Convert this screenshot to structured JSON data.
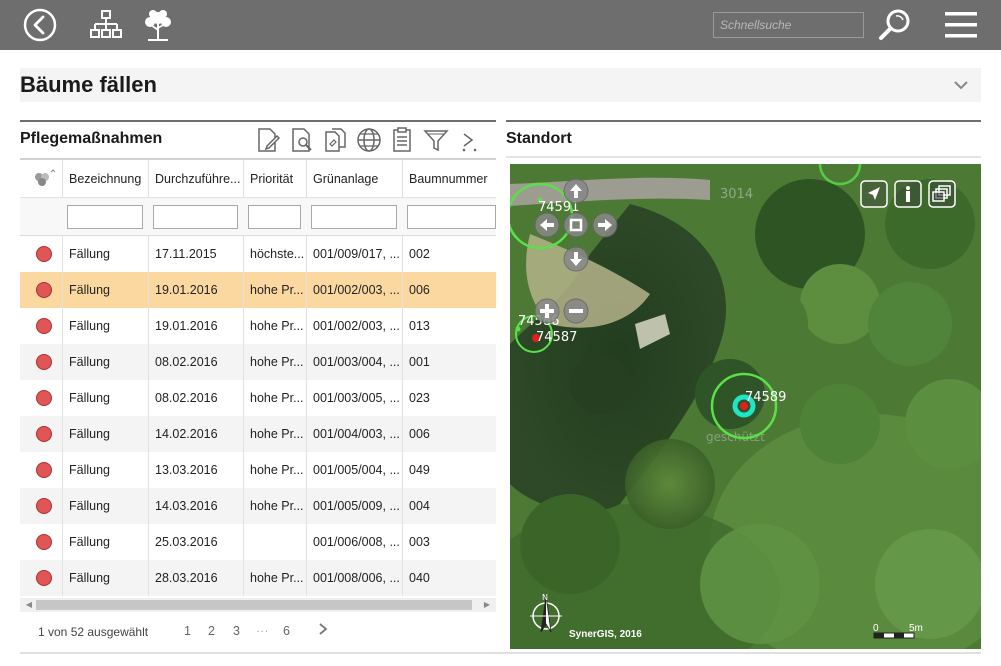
{
  "app": {
    "search_placeholder": "Schnellsuche",
    "icons": [
      "back-icon",
      "sitemap-icon",
      "tree-icon",
      "search-icon",
      "menu-icon"
    ]
  },
  "page": {
    "title": "Bäume fällen"
  },
  "left_panel": {
    "title": "Pflegemaßnahmen",
    "toolbar_icons": [
      "edit-icon",
      "search-document-icon",
      "copy-icon",
      "globe-icon",
      "clipboard-icon",
      "filter-icon",
      "more-icon"
    ],
    "columns": [
      "Bezeichnung",
      "Durchzuführe...",
      "Priorität",
      "Grünanlage",
      "Baumnummer"
    ],
    "rows": [
      {
        "bez": "Fällung",
        "datum": "17.11.2015",
        "prio": "höchste...",
        "anlage": "001/009/017, ...",
        "nr": "002"
      },
      {
        "bez": "Fällung",
        "datum": "19.01.2016",
        "prio": "hohe Pr...",
        "anlage": "001/002/003, ...",
        "nr": "006"
      },
      {
        "bez": "Fällung",
        "datum": "19.01.2016",
        "prio": "hohe Pr...",
        "anlage": "001/002/003, ...",
        "nr": "013"
      },
      {
        "bez": "Fällung",
        "datum": "08.02.2016",
        "prio": "hohe Pr...",
        "anlage": "001/003/004, ...",
        "nr": "001"
      },
      {
        "bez": "Fällung",
        "datum": "08.02.2016",
        "prio": "hohe Pr...",
        "anlage": "001/003/005, ...",
        "nr": "023"
      },
      {
        "bez": "Fällung",
        "datum": "14.02.2016",
        "prio": "hohe Pr...",
        "anlage": "001/004/003, ...",
        "nr": "006"
      },
      {
        "bez": "Fällung",
        "datum": "13.03.2016",
        "prio": "hohe Pr...",
        "anlage": "001/005/004, ...",
        "nr": "049"
      },
      {
        "bez": "Fällung",
        "datum": "14.03.2016",
        "prio": "hohe Pr...",
        "anlage": "001/005/009, ...",
        "nr": "004"
      },
      {
        "bez": "Fällung",
        "datum": "25.03.2016",
        "prio": "",
        "anlage": "001/006/008, ...",
        "nr": "003"
      },
      {
        "bez": "Fällung",
        "datum": "28.03.2016",
        "prio": "hohe Pr...",
        "anlage": "001/008/006, ...",
        "nr": "040"
      }
    ],
    "selected_row": 1,
    "status_color": "#e05555",
    "pager": {
      "info": "1 von 52 ausgewählt",
      "pages": [
        "1",
        "2",
        "3",
        "···",
        "6"
      ]
    }
  },
  "right_panel": {
    "title": "Standort",
    "map": {
      "markers": [
        "74591",
        "74586",
        "74587",
        "74589"
      ],
      "faded_labels": [
        "3014",
        "geschützt"
      ],
      "copyright": "SynerGIS, 2016",
      "scale_start": "0",
      "scale_end": "5m",
      "north_label": "N",
      "controls": [
        "pan-up-icon",
        "pan-left-icon",
        "pan-center-icon",
        "pan-right-icon",
        "pan-down-icon",
        "zoom-in-icon",
        "zoom-out-icon",
        "locate-icon",
        "info-icon",
        "layers-icon"
      ]
    }
  }
}
